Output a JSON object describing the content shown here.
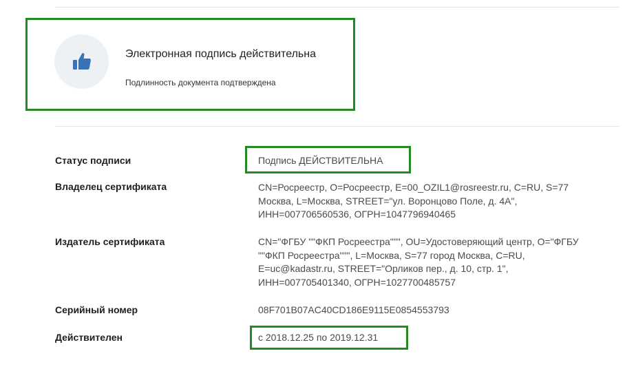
{
  "banner": {
    "icon": "thumbs-up-icon",
    "title": "Электронная подпись действительна",
    "subtitle": "Подлинность документа подтверждена"
  },
  "details": {
    "status": {
      "label": "Статус подписи",
      "value": "Подпись ДЕЙСТВИТЕЛЬНА"
    },
    "owner": {
      "label": "Владелец сертификата",
      "value_lines": [
        "CN=Росреестр, O=Росреестр, E=00_OZIL1@rosreestr.ru, C=RU, S=77",
        "Москва, L=Москва, STREET=\"ул. Воронцово Поле, д. 4А\",",
        "ИНН=007706560536, ОГРН=1047796940465"
      ]
    },
    "issuer": {
      "label": "Издатель сертификата",
      "value_lines": [
        "CN=\"ФГБУ \"\"ФКП Росреестра\"\"\", OU=Удостоверяющий центр, O=\"ФГБУ",
        "\"\"ФКП Росреестра\"\"\", L=Москва, S=77 город Москва, C=RU,",
        "E=uc@kadastr.ru, STREET=\"Орликов пер., д. 10, стр. 1\",",
        "ИНН=007705401340, ОГРН=1027700485757"
      ]
    },
    "serial": {
      "label": "Серийный номер",
      "value": "08F701B07AC40CD186E9115E0854553793"
    },
    "validity": {
      "label": "Действителен",
      "value": "с 2018.12.25 по 2019.12.31"
    }
  },
  "colors": {
    "highlight_border": "#218a21",
    "icon_blue": "#3a72b8",
    "icon_circle_bg": "#eef1f4"
  }
}
